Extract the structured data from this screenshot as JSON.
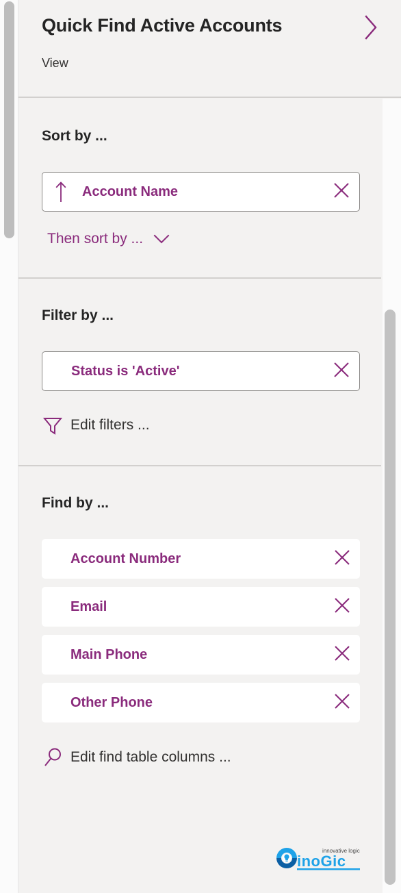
{
  "panel": {
    "header": {
      "title": "Quick Find Active Accounts",
      "subtitle": "View",
      "expand_icon": "chevron-right-icon"
    },
    "sort_section": {
      "title": "Sort by ...",
      "items": [
        {
          "label": "Account Name",
          "direction_icon": "arrow-up-icon",
          "remove_icon": "close-icon"
        }
      ],
      "add_link": {
        "label": "Then sort by ...",
        "icon": "chevron-down-icon"
      }
    },
    "filter_section": {
      "title": "Filter by ...",
      "items": [
        {
          "label": "Status is 'Active'",
          "remove_icon": "close-icon"
        }
      ],
      "edit_link": {
        "label": "Edit filters ...",
        "icon": "filter-funnel-icon"
      }
    },
    "find_section": {
      "title": "Find by ...",
      "items": [
        {
          "label": "Account Number",
          "remove_icon": "close-icon"
        },
        {
          "label": "Email",
          "remove_icon": "close-icon"
        },
        {
          "label": "Main Phone",
          "remove_icon": "close-icon"
        },
        {
          "label": "Other Phone",
          "remove_icon": "close-icon"
        }
      ],
      "edit_link": {
        "label": "Edit find table columns ...",
        "icon": "search-icon"
      }
    }
  },
  "watermark": {
    "tagline": "innovative logic",
    "name": "inoGic"
  },
  "colors": {
    "accent": "#8a2b7c",
    "panel_bg": "#f3f2f1",
    "chip_bg": "#ffffff",
    "divider": "#d2d0ce",
    "text": "#242424",
    "scrollbar": "#bdbdbd"
  }
}
